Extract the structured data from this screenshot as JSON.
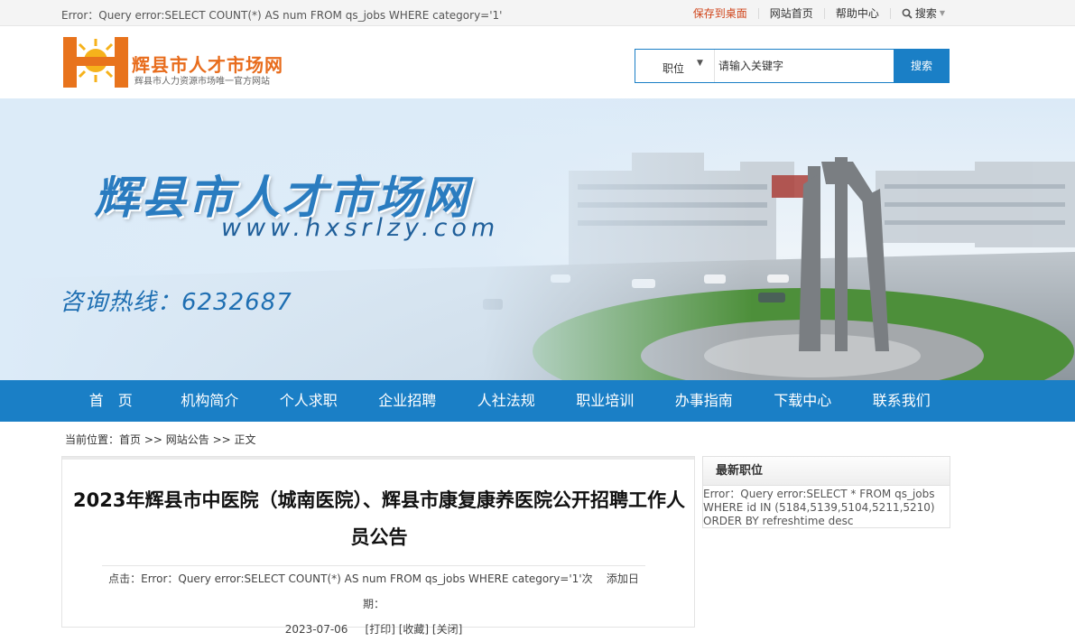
{
  "topbar": {
    "error": "Error：Query error:SELECT COUNT(*) AS num FROM qs_jobs WHERE category='1'",
    "links": [
      "保存到桌面",
      "网站首页",
      "帮助中心"
    ],
    "search_label": "搜索",
    "accent": "#d0451b"
  },
  "header": {
    "site_name": "辉县市人才市场网",
    "tagline": "辉县市人力资源市场唯一官方网站",
    "search": {
      "category": "职位",
      "placeholder": "请输入关键字",
      "button": "搜索"
    }
  },
  "banner": {
    "title": "辉县市人才市场网",
    "url": "www.hxsrlzy.com",
    "hotline": "咨询热线：6232687"
  },
  "nav": {
    "items": [
      "首　页",
      "机构简介",
      "个人求职",
      "企业招聘",
      "人社法规",
      "职业培训",
      "办事指南",
      "下载中心",
      "联系我们"
    ],
    "color": "#1a7fc6"
  },
  "breadcrumb": {
    "prefix": "当前位置：",
    "home": "首页",
    "sep1": " >> ",
    "section": "网站公告",
    "sep2": " >> ",
    "current": "正文"
  },
  "article": {
    "title": "2023年辉县市中医院（城南医院）、辉县市康复康养医院公开招聘工作人员公告",
    "hits_label": "点击：",
    "hits_value": "Error：Query error:SELECT COUNT(*) AS num FROM qs_jobs WHERE category='1'",
    "hits_unit": "次",
    "date_label": "添加日期：",
    "date": "2023-07-06",
    "print": "打印",
    "favorite": "收藏",
    "close": "关闭"
  },
  "sidebar": {
    "title": "最新职位",
    "error": "Error：Query error:SELECT * FROM qs_jobs WHERE id IN (5184,5139,5104,5211,5210) ORDER BY refreshtime desc"
  }
}
